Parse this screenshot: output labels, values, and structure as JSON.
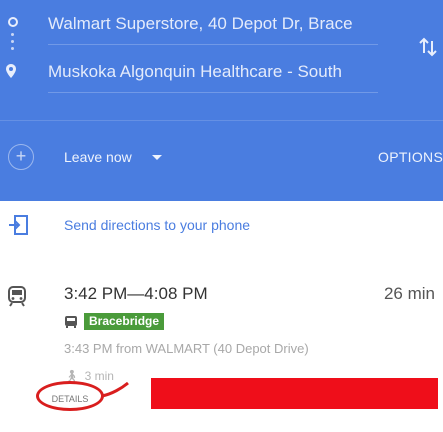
{
  "directions": {
    "origin": "Walmart Superstore, 40 Depot Dr, Brace",
    "destination": "Muskoka Algonquin Healthcare - South"
  },
  "controls": {
    "leave_now": "Leave now",
    "options": "OPTIONS",
    "add_icon": "+"
  },
  "send": {
    "label": "Send directions to your phone"
  },
  "trip": {
    "time_range": "3:42 PM—4:08 PM",
    "duration": "26 min",
    "route_name": "Bracebridge",
    "departure": "3:43 PM from WALMART (40 Depot Drive)",
    "walk": "3 min",
    "details_label": "DETAILS"
  },
  "colors": {
    "header_blue": "#4a7de0",
    "route_green": "#4a9b3a",
    "annotation_red": "#d91e1e",
    "redaction_red": "#ef0e1a"
  }
}
